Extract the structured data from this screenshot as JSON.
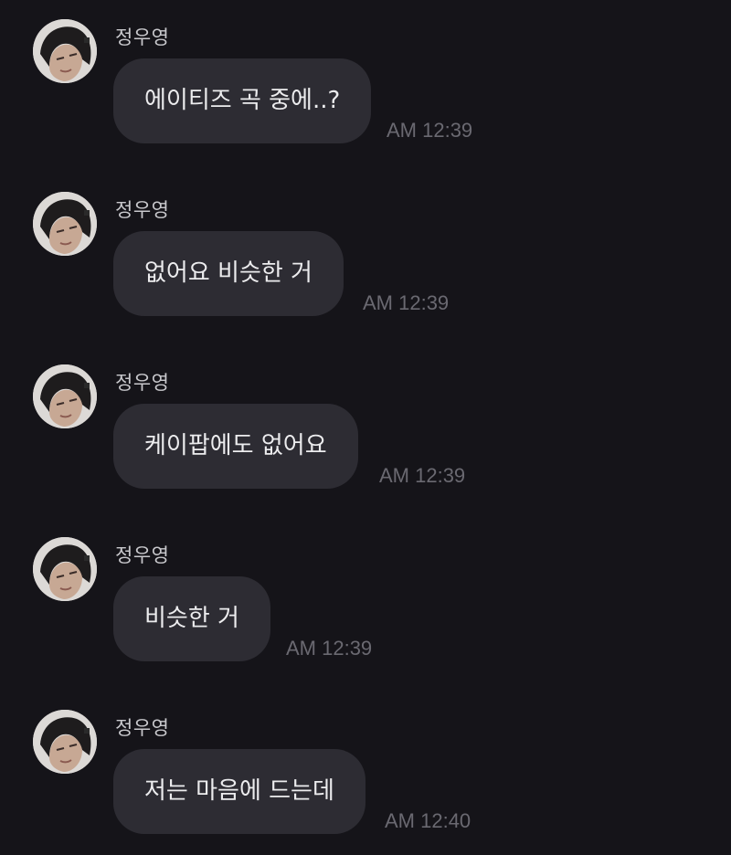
{
  "messages": [
    {
      "sender": "정우영",
      "text": "에이티즈 곡 중에..?",
      "time": "AM 12:39"
    },
    {
      "sender": "정우영",
      "text": "없어요 비슷한 거",
      "time": "AM 12:39"
    },
    {
      "sender": "정우영",
      "text": "케이팝에도 없어요",
      "time": "AM 12:39"
    },
    {
      "sender": "정우영",
      "text": "비슷한 거",
      "time": "AM 12:39"
    },
    {
      "sender": "정우영",
      "text": "저는 마음에 드는데",
      "time": "AM 12:40"
    }
  ],
  "colors": {
    "background": "#151419",
    "bubble": "#2d2c33",
    "message_text": "#ececee",
    "sender_text": "#c9c9cd",
    "time_text": "#6a6971"
  },
  "icons": {
    "avatar": "profile-photo-avatar"
  }
}
